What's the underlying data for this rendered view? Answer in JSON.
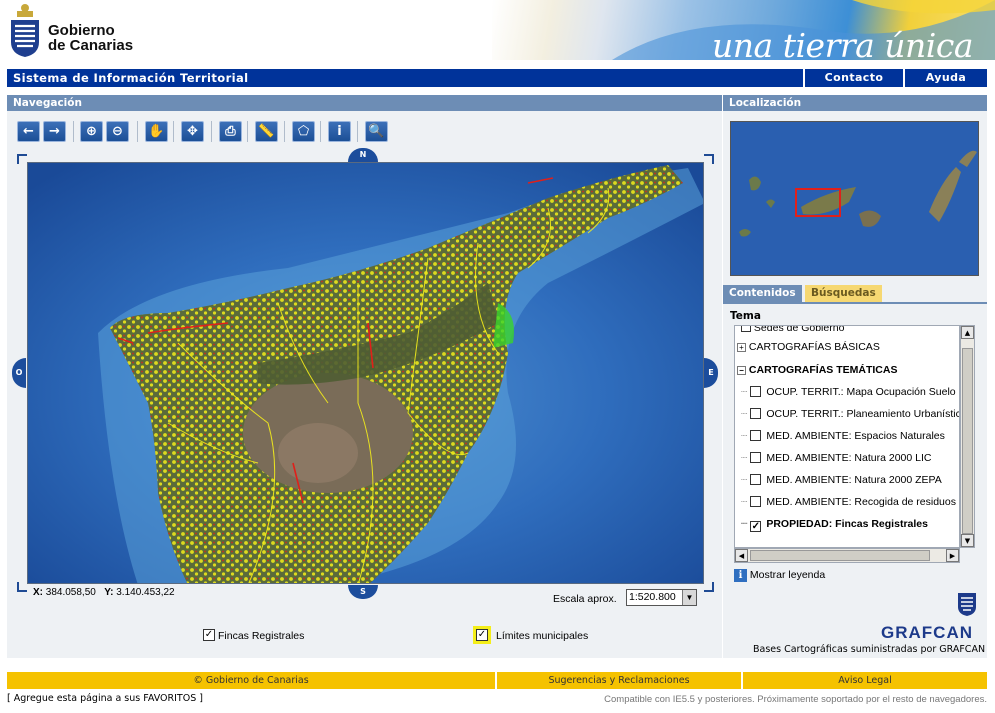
{
  "header": {
    "org_line1": "Gobierno",
    "org_line2": "de Canarias",
    "slogan": "una tierra única"
  },
  "topbar": {
    "title": "Sistema de Información Territorial",
    "contact_label": "Contacto",
    "help_label": "Ayuda"
  },
  "navigation": {
    "title": "Navegación",
    "toolbar": [
      {
        "name": "back-icon",
        "glyph": "←"
      },
      {
        "name": "forward-icon",
        "glyph": "→"
      },
      {
        "name": "zoom-in-icon",
        "glyph": "⊕"
      },
      {
        "name": "zoom-out-icon",
        "glyph": "⊖"
      },
      {
        "name": "pan-hand-icon",
        "glyph": "✋"
      },
      {
        "name": "full-extent-icon",
        "glyph": "✥"
      },
      {
        "name": "print-icon",
        "glyph": "⎙"
      },
      {
        "name": "measure-ruler-icon",
        "glyph": "📏"
      },
      {
        "name": "area-polygon-icon",
        "glyph": "⬠"
      },
      {
        "name": "info-icon",
        "glyph": "i"
      },
      {
        "name": "zoom-search-icon",
        "glyph": "🔍"
      }
    ],
    "compass": {
      "n": "N",
      "s": "S",
      "o": "O",
      "e": "E"
    },
    "coords": {
      "x_label": "X:",
      "x_value": "384.058,50",
      "y_label": "Y:",
      "y_value": "3.140.453,22"
    },
    "scale_label": "Escala aprox.",
    "scale_value": "1:520.800",
    "layer_fincas": "Fincas Registrales",
    "layer_limites": "Límites municipales"
  },
  "location": {
    "title": "Localización",
    "tabs": {
      "contents": "Contenidos",
      "searches": "Búsquedas"
    },
    "tema_label": "Tema",
    "tree": [
      {
        "label": "Sedes de Gobierno",
        "checked": false,
        "bold": false
      },
      {
        "label": "CARTOGRAFÍAS BÁSICAS",
        "bold": false
      },
      {
        "label": "CARTOGRAFÍAS TEMÁTICAS",
        "bold": true
      },
      {
        "label": "OCUP. TERRIT.: Mapa Ocupación Suelo",
        "checked": false,
        "bold": false
      },
      {
        "label": "OCUP. TERRIT.: Planeamiento Urbanístico",
        "checked": false,
        "bold": false
      },
      {
        "label": "MED. AMBIENTE: Espacios Naturales",
        "checked": false,
        "bold": false
      },
      {
        "label": "MED. AMBIENTE: Natura 2000 LIC",
        "checked": false,
        "bold": false
      },
      {
        "label": "MED. AMBIENTE: Natura 2000 ZEPA",
        "checked": false,
        "bold": false
      },
      {
        "label": "MED. AMBIENTE: Recogida de residuos",
        "checked": false,
        "bold": false
      },
      {
        "label": "PROPIEDAD: Fincas Registrales",
        "checked": true,
        "bold": true
      }
    ],
    "legend_link": "Mostrar leyenda",
    "grafcan_logo": "GRAFCAN",
    "grafcan_credit": "Bases Cartográficas suministradas por GRAFCAN"
  },
  "footer": {
    "copyright": "© Gobierno de Canarias",
    "suggestions": "Sugerencias y Reclamaciones",
    "legal": "Aviso Legal",
    "favorites": "[ Agregue esta página a sus FAVORITOS ]",
    "compat": "Compatible con IE5.5 y posteriores. Próximamente soportado por el resto de navegadores."
  },
  "colors": {
    "brand_blue": "#00339a",
    "panel_header": "#6d8db5",
    "footer_yellow": "#f5c200",
    "parcel_yellow": "#f4ee1a",
    "parcel_red": "#e0201a"
  }
}
